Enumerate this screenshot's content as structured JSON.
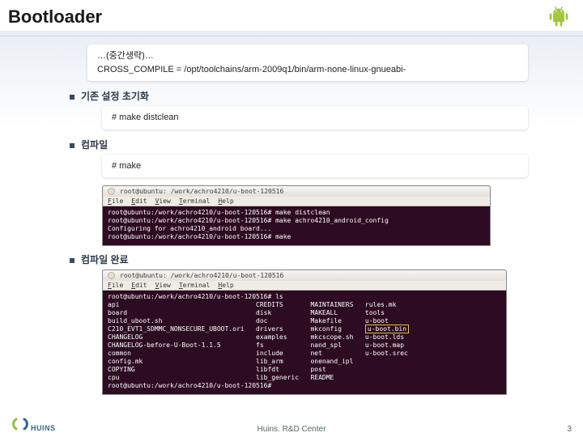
{
  "header": {
    "title": "Bootloader"
  },
  "box_omit": {
    "line1": "…(중간생략)…",
    "line2": "CROSS_COMPILE = /opt/toolchains/arm-2009q1/bin/arm-none-linux-gnueabi-"
  },
  "sec_init": {
    "label": "기존 설정 초기화",
    "cmd": "#  make distclean"
  },
  "sec_compile": {
    "label": "컴파일",
    "cmd": "#  make"
  },
  "sec_done": {
    "label": "컴파일 완료"
  },
  "term1": {
    "title": "root@ubuntu: /work/achro4210/u-boot-120516",
    "menu": [
      "File",
      "Edit",
      "View",
      "Terminal",
      "Help"
    ],
    "l1": "root@ubuntu:/work/achro4210/u-boot-120516# make distclean",
    "l2": "root@ubuntu:/work/achro4210/u-boot-120516# make achro4210_android_config",
    "l3": "Configuring for achro4210_android board...",
    "l4": "root@ubuntu:/work/achro4210/u-boot-120516# make"
  },
  "term2": {
    "title": "root@ubuntu: /work/achro4210/u-boot-120516",
    "menu": [
      "File",
      "Edit",
      "View",
      "Terminal",
      "Help"
    ],
    "prompt_ls": "root@ubuntu:/work/achro4210/u-boot-120516# ls",
    "cols": {
      "c1": [
        "api",
        "board",
        "build_uboot.sh",
        "C210_EVT1_SDMMC_NONSECURE_UBOOT.ori",
        "CHANGELOG",
        "CHANGELOG-before-U-Boot-1.1.5",
        "common",
        "config.mk",
        "COPYING",
        "cpu"
      ],
      "c2": [
        "CREDITS",
        "disk",
        "doc",
        "drivers",
        "examples",
        "fs",
        "include",
        "lib_arm",
        "libfdt",
        "lib_generic"
      ],
      "c3": [
        "MAINTAINERS",
        "MAKEALL",
        "Makefile",
        "mkconfig",
        "mkcscope.sh",
        "nand_spl",
        "net",
        "onenand_ipl",
        "post",
        "README"
      ],
      "c4": [
        "rules.mk",
        "tools",
        "u-boot",
        "u-boot.bin",
        "u-boot.lds",
        "u-boot.map",
        "u-boot.srec"
      ]
    },
    "hl": "u-boot.bin",
    "prompt_end": "root@ubuntu:/work/achro4210/u-boot-120516#"
  },
  "footer": {
    "center": "Huins. R&D Center",
    "page": "3",
    "brand": "HUINS"
  }
}
